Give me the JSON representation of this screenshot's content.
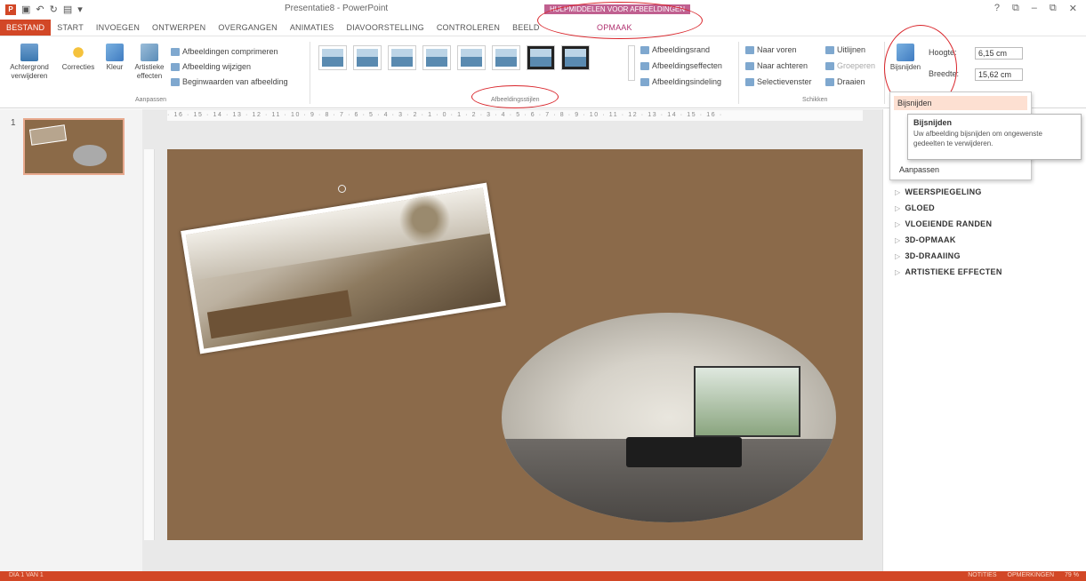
{
  "app": {
    "title": "Presentatie8 - PowerPoint",
    "context_tab_group": "HULPMIDDELEN VOOR AFBEELDINGEN",
    "window_controls": [
      "?",
      "⧉",
      "–",
      "⧉",
      "✕"
    ]
  },
  "tabs": [
    "BESTAND",
    "START",
    "INVOEGEN",
    "ONTWERPEN",
    "OVERGANGEN",
    "ANIMATIES",
    "DIAVOORSTELLING",
    "CONTROLEREN",
    "BEELD"
  ],
  "context_tab": "OPMAAK",
  "ribbon": {
    "aanpassen": {
      "remove_bg": "Achtergrond verwijderen",
      "corrections": "Correcties",
      "color": "Kleur",
      "artistic": "Artistieke effecten",
      "compress": "Afbeeldingen comprimeren",
      "change_picture": "Afbeelding wijzigen",
      "reset_picture": "Beginwaarden van afbeelding",
      "group_label": "Aanpassen"
    },
    "styles": {
      "group_label": "Afbeeldingsstijlen",
      "border": "Afbeeldingsrand",
      "effects": "Afbeeldingseffecten",
      "layout": "Afbeeldingsindeling"
    },
    "arrange": {
      "bring_forward": "Naar voren",
      "send_backward": "Naar achteren",
      "selection_pane": "Selectievenster",
      "align": "Uitlijnen",
      "group": "Groeperen",
      "rotate": "Draaien",
      "group_label": "Schikken"
    },
    "size": {
      "crop": "Bijsnijden",
      "height_label": "Hoogte:",
      "height_value": "6,15 cm",
      "width_label": "Breedte:",
      "width_value": "15,62 cm"
    }
  },
  "ruler_h": "· 16 · 15 · 14 · 13 · 12 · 11 · 10 · 9 · 8 · 7 · 6 · 5 · 4 · 3 · 2 · 1 · 0 · 1 · 2 · 3 · 4 · 5 · 6 · 7 · 8 · 9 · 10 · 11 · 12 · 13 · 14 · 15 · 16 ·",
  "thumbnails": [
    {
      "number": "1"
    }
  ],
  "crop_menu": {
    "crop_item": "Bijsnijden",
    "adjust_item": "Aanpassen"
  },
  "tooltip": {
    "title": "Bijsnijden",
    "description": "Uw afbeelding bijsnijden om ongewenste gedeelten te verwijderen."
  },
  "format_pane": {
    "sections": [
      "WEERSPIEGELING",
      "GLOED",
      "VLOEIENDE RANDEN",
      "3D-OPMAAK",
      "3D-DRAAIING",
      "ARTISTIEKE EFFECTEN"
    ]
  },
  "status": {
    "slide_info": "DIA 1 VAN 1",
    "notes": "NOTITIES",
    "comments": "OPMERKINGEN",
    "zoom": "79 %"
  },
  "colors": {
    "accent": "#d24726",
    "slide_bg": "#8b6a4a",
    "context_tab": "#b0306f",
    "annotation": "#d9242a"
  }
}
